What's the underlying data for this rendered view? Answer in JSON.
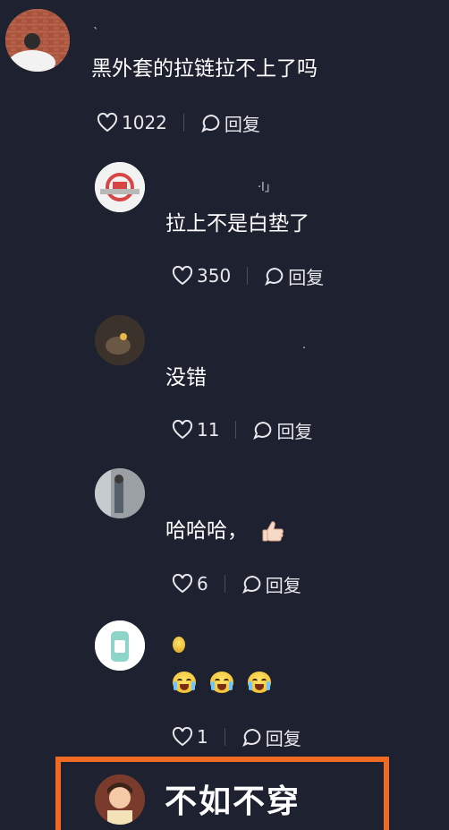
{
  "comments": [
    {
      "text": "黑外套的拉链拉不上了吗",
      "likes": "1022",
      "reply_label": "回复",
      "username": "`"
    },
    {
      "text": "拉上不是白垫了",
      "likes": "350",
      "reply_label": "回复",
      "username": "·l」"
    },
    {
      "text": "没错",
      "likes": "11",
      "reply_label": "回复",
      "username": "·"
    },
    {
      "text": "哈哈哈，",
      "likes": "6",
      "reply_label": "回复"
    },
    {
      "likes": "1",
      "reply_label": "回复"
    }
  ],
  "highlight": {
    "text": "不如不穿",
    "border_color": "#f26a22"
  },
  "colors": {
    "background": "#1e2130",
    "text": "#ffffff",
    "separator": "#4a4d5c"
  },
  "icons": {
    "like": "heart-outline-icon",
    "reply": "speech-bubble-icon",
    "thumbs_up": "thumbs-up-emoji",
    "crying": "loudly-crying-face-emoji"
  }
}
